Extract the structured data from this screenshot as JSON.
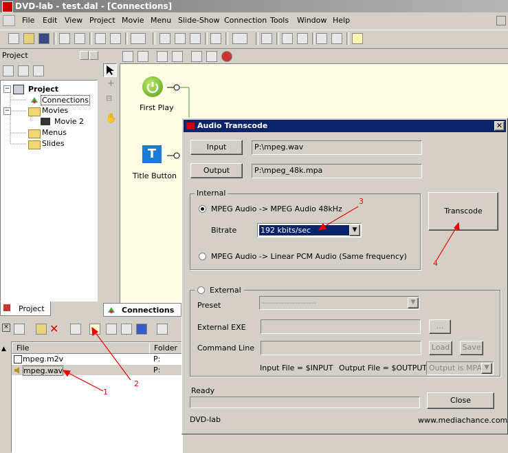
{
  "window": {
    "title": "DVD-lab - test.dal - [Connections]"
  },
  "menu": [
    "File",
    "Edit",
    "View",
    "Project",
    "Movie",
    "Menu",
    "Slide-Show",
    "Connection",
    "Tools",
    "Window",
    "Help"
  ],
  "project_panel": {
    "title": "Project",
    "tree": {
      "root": "Project",
      "connections": "Connections",
      "movies": "Movies",
      "movie2": "Movie 2",
      "menus": "Menus",
      "slides": "Slides"
    },
    "tab": "Project"
  },
  "canvas": {
    "first_play": "First Play",
    "title_button": "Title Button",
    "tab": "Connections"
  },
  "files_panel": {
    "headers": [
      "File",
      "Folder"
    ],
    "rows": [
      {
        "name": "mpeg.m2v",
        "folder": "P:"
      },
      {
        "name": "mpeg.wav",
        "folder": "P:"
      }
    ]
  },
  "dialog": {
    "title": "Audio Transcode",
    "input_label": "Input",
    "input_value": "P:\\mpeg.wav",
    "output_label": "Output",
    "output_value": "P:\\mpeg_48k.mpa",
    "internal_group": "Internal",
    "option1": "MPEG Audio -> MPEG Audio 48kHz",
    "bitrate_label": "Bitrate",
    "bitrate_value": "192 kbits/sec",
    "option2": "MPEG Audio -> Linear PCM Audio (Same frequency)",
    "transcode_label": "Transcode",
    "external_label": "External",
    "preset_label": "Preset",
    "preset_value": "--------------------",
    "exe_label": "External EXE",
    "browse_label": "...",
    "cmd_label": "Command Line",
    "load_label": "Load",
    "save_label": "Save",
    "input_hint": "Input File = $INPUT",
    "output_hint": "Output File = $OUTPUT",
    "output_type": "Output is MPA",
    "status": "Ready",
    "close_label": "Close",
    "footer_left": "DVD-lab",
    "footer_right": "www.mediachance.com"
  },
  "annotations": [
    "1",
    "2",
    "3",
    "4"
  ],
  "colors": {
    "annotation": "#ee0000",
    "highlight": "#0a246a"
  }
}
